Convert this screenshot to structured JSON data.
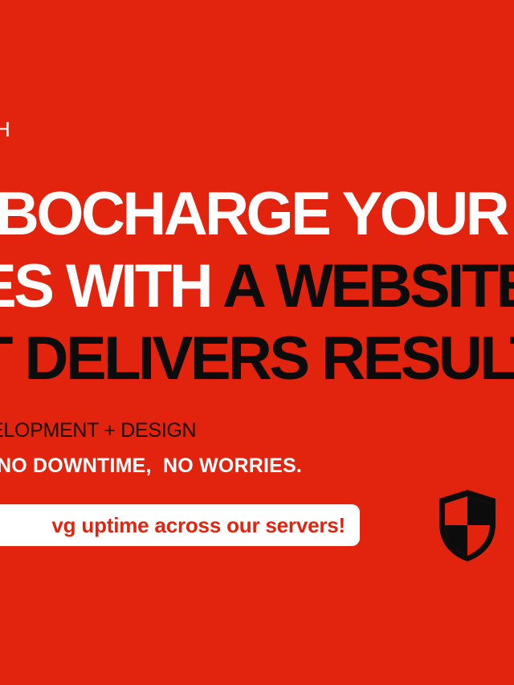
{
  "eyebrow": "H",
  "headline": {
    "line1_white": "BOCHARGE YOUR",
    "line2_white": "ES WITH ",
    "line2_black": "A WEBSITE",
    "line3_black": "T DELIVERS RESULT"
  },
  "service_line": "ELOPMENT + DESIGN",
  "tagline": "NO DOWNTIME,  NO WORRIES.",
  "uptime_pill": "vg uptime across our servers!",
  "shield_icon": "shield-icon",
  "colors": {
    "background": "#e2240f",
    "white": "#ffffff",
    "black": "#0c0c0c"
  }
}
